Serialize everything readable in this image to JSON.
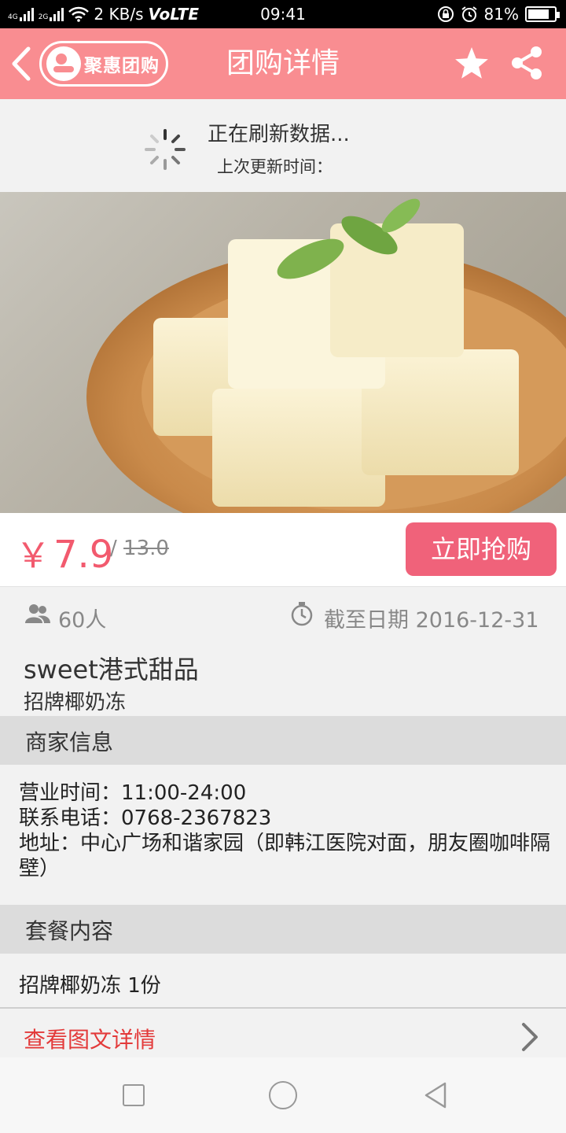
{
  "status_bar": {
    "net1": "4G",
    "net2": "2G",
    "speed": "2 KB/s",
    "volte": "VoLTE",
    "time": "09:41",
    "battery": "81%",
    "battery_level": 0.81
  },
  "header": {
    "logo_text": "聚惠团购",
    "title": "团购详情",
    "back_icon": "chevron-left-icon",
    "favorite_icon": "star-icon",
    "share_icon": "share-icon"
  },
  "refresh": {
    "title": "正在刷新数据...",
    "subtitle": "上次更新时间："
  },
  "product": {
    "currency": "￥",
    "price": "7.9",
    "separator": "/",
    "original_price": "13.0",
    "buy_label": "立即抢购",
    "people": "60人",
    "deadline": "截至日期 2016-12-31",
    "shop_name": "sweet港式甜品",
    "item_name": "招牌椰奶冻"
  },
  "merchant": {
    "heading": "商家信息",
    "hours": "营业时间：11:00-24:00",
    "phone": "联系电话：0768-2367823",
    "address": "地址：中心广场和谐家园（即韩江医院对面，朋友圈咖啡隔壁）"
  },
  "package": {
    "heading": "套餐内容",
    "content": "招牌椰奶冻 1份"
  },
  "detail_link": "查看图文详情",
  "colors": {
    "header": "#f98d91",
    "accent": "#f0627a",
    "price": "#f25a6e",
    "link": "#e33a3a"
  }
}
